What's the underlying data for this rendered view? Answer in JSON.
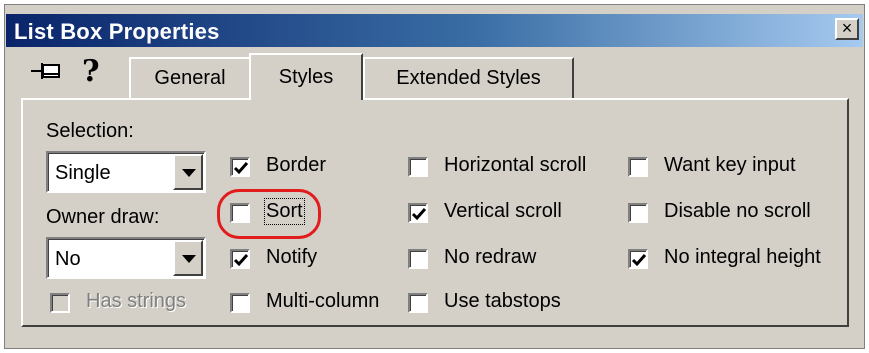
{
  "window": {
    "title": "List Box Properties",
    "close_glyph": "×"
  },
  "toolbar": {
    "pin_icon": "pin-icon",
    "help_icon": "help-icon",
    "help_glyph": "?"
  },
  "tabs": [
    {
      "label": "General",
      "active": false
    },
    {
      "label": "Styles",
      "active": true
    },
    {
      "label": "Extended Styles",
      "active": false
    }
  ],
  "styles": {
    "selection_label": "Selection:",
    "selection_value": "Single",
    "owner_draw_label": "Owner draw:",
    "owner_draw_value": "No",
    "options": {
      "has_strings": {
        "label": "Has strings",
        "checked": false,
        "enabled": false
      },
      "border": {
        "label": "Border",
        "checked": true
      },
      "sort": {
        "label": "Sort",
        "checked": false
      },
      "notify": {
        "label": "Notify",
        "checked": true
      },
      "multi_column": {
        "label": "Multi-column",
        "checked": false
      },
      "horizontal_scroll": {
        "label": "Horizontal scroll",
        "checked": false
      },
      "vertical_scroll": {
        "label": "Vertical scroll",
        "checked": true
      },
      "no_redraw": {
        "label": "No redraw",
        "checked": false
      },
      "use_tabstops": {
        "label": "Use tabstops",
        "checked": false
      },
      "want_key_input": {
        "label": "Want key input",
        "checked": false
      },
      "disable_no_scroll": {
        "label": "Disable no scroll",
        "checked": false
      },
      "no_integral_height": {
        "label": "No integral height",
        "checked": true
      }
    }
  },
  "annotation": {
    "color": "#e21c1c",
    "target": "Sort"
  },
  "colors": {
    "title_start": "#0a246a",
    "title_end": "#a6caf0",
    "face": "#d4d0c8"
  }
}
